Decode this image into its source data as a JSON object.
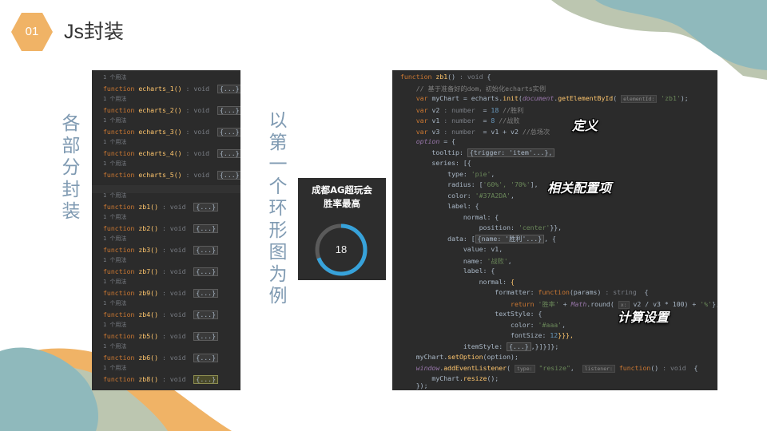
{
  "slide": {
    "number": "01",
    "title": "Js封装",
    "left_caption": "各部分封装",
    "mid_caption": "以第一个环形图为例",
    "colors": {
      "accent": "#f0b366",
      "teal": "#8fb9bc",
      "sage": "#bcc6b0",
      "code_bg": "#2b2b2b"
    }
  },
  "functions_panel": {
    "usage_hint": "1 个用法",
    "keyword": "function",
    "type_hint": ": void",
    "fold": "{...}",
    "group1": [
      "echarts_1() ",
      "echarts_2() ",
      "echarts_3() ",
      "echarts_4() ",
      "echarts_5() "
    ],
    "group2": [
      "zb1() ",
      "zb2() ",
      "zb3() ",
      "zb7() ",
      "zb9() ",
      "zb4() ",
      "zb5() ",
      "zb6() ",
      "zb8() "
    ]
  },
  "code_panel": {
    "l1_kw": "function ",
    "l1_fn": "zb1",
    "l1_rest": "() ",
    "l1_type": ": void",
    "l1_end": " {",
    "l2": "    // 基于准备好的dom，初始化echarts实例",
    "l3_var": "    var",
    "l3_a": " myChart = echarts.",
    "l3_init": "init",
    "l3_b": "(",
    "l3_doc": "document",
    "l3_c": ".",
    "l3_get": "getElementById",
    "l3_d": "( ",
    "l3_hint": "elementId:",
    "l3_str": " 'zb1'",
    "l3_e": ");",
    "l4_var": "    var",
    "l4_a": " v2 ",
    "l4_type": ": number",
    "l4_b": "  = ",
    "l4_num": "18",
    "l4_cm": " //胜利",
    "l5_var": "    var",
    "l5_a": " v1 ",
    "l5_type": ": number",
    "l5_b": "  = ",
    "l5_num": "8",
    "l5_cm": " //战败",
    "l6_var": "    var",
    "l6_a": " v3 ",
    "l6_type": ": number",
    "l6_b": "  = v1 + v2 ",
    "l6_cm": "//总场次",
    "l7_opt": "    option",
    "l7_rest": " = {",
    "l8_a": "        tooltip: ",
    "l8_b": "{trigger: 'item'...},",
    "l9": "        series: [{",
    "l10_a": "            type: ",
    "l10_s": "'pie'",
    "l10_e": ",",
    "l11_a": "            radius: [",
    "l11_s": "'60%', '70%'",
    "l11_e": "],",
    "l12_a": "            color: ",
    "l12_s": "'#37A2DA'",
    "l12_e": ",",
    "l13": "            label: {",
    "l14": "                normal: {",
    "l15_a": "                    position: ",
    "l15_s": "'center'",
    "l15_e": "}},",
    "l16_a": "            data: [",
    "l16_b": "{name: '胜利'...}",
    "l16_e": ", {",
    "l17": "                value: v1,",
    "l18_a": "                name: ",
    "l18_s": "'战败'",
    "l18_e": ",",
    "l19": "                label: {",
    "l20_a": "                    normal: ",
    "l20_b": "{",
    "l21_a": "                        formatter: ",
    "l21_kw": "function",
    "l21_b": "(params) ",
    "l21_type": ": string",
    "l21_e": "  {",
    "l22_a": "                            return ",
    "l22_s": "'胜率' ",
    "l22_b": "+ ",
    "l22_m": "Math",
    "l22_c": ".round( ",
    "l22_hint": "x:",
    "l22_d": " v2 / v3 * 100) + ",
    "l22_s2": "'%'",
    "l22_e": "},",
    "l23": "                        textStyle: {",
    "l24_a": "                            color: ",
    "l24_s": "'#aaa'",
    "l24_e": ",",
    "l25_a": "                            fontSize: ",
    "l25_n": "12",
    "l25_e": "}}},",
    "l26_a": "                itemStyle: ",
    "l26_b": "{...}",
    "l26_e": ",}]}]};",
    "l27_a": "    myChart.",
    "l27_fn": "setOption",
    "l27_e": "(option);",
    "l28_w": "    window",
    "l28_a": ".",
    "l28_fn": "addEventListener",
    "l28_b": "( ",
    "l28_h1": "type:",
    "l28_s": " \"resize\"",
    "l28_c": ",  ",
    "l28_h2": "listener:",
    "l28_kw": " function",
    "l28_d": "() ",
    "l28_type": ": void",
    "l28_e": "  {",
    "l29_a": "        myChart.",
    "l29_fn": "resize",
    "l29_e": "();",
    "l30": "    });"
  },
  "stickers": {
    "define": "定义",
    "config": "相关配置项",
    "calc": "计算设置"
  },
  "donut": {
    "title_line1": "成都AG超玩会",
    "title_line2": "胜率最高",
    "value_label": "18",
    "win": 18,
    "loss": 8,
    "colors": {
      "win": "#37a2da",
      "loss": "#5a5a5a",
      "bg": "#2d2d2d"
    }
  }
}
